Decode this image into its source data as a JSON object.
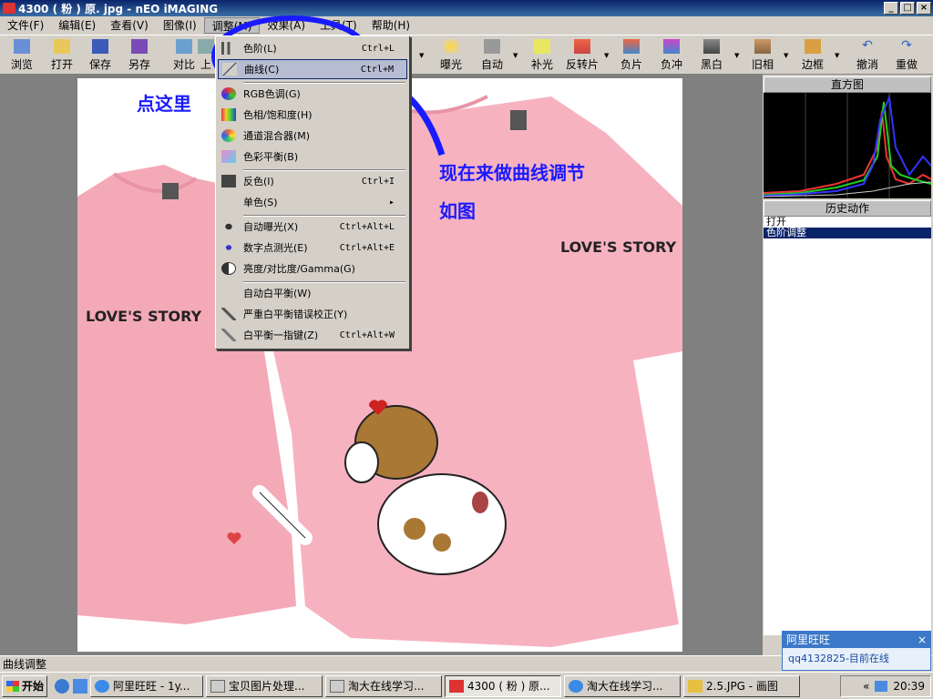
{
  "window": {
    "title": "4300 ( 粉 ) 原. jpg - nEO iMAGING",
    "buttons": [
      "_",
      "□",
      "×"
    ]
  },
  "menubar": [
    "文件(F)",
    "编辑(E)",
    "查看(V)",
    "图像(I)",
    "调整(M)",
    "效果(A)",
    "工具(T)",
    "帮助(H)"
  ],
  "toolbar": {
    "browse": "浏览",
    "open": "打开",
    "save": "保存",
    "saveas": "另存",
    "compare": "对比",
    "up": "上",
    "exposure": "曝光",
    "auto": "自动",
    "fill": "补光",
    "reverse": "反转片",
    "negative": "负片",
    "negative_process": "负冲",
    "bw": "黑白",
    "old": "旧相",
    "border": "边框",
    "undo": "撤消",
    "redo": "重做"
  },
  "dropdown": {
    "levels": {
      "label": "色阶(L)",
      "shortcut": "Ctrl+L"
    },
    "curves": {
      "label": "曲线(C)",
      "shortcut": "Ctrl+M"
    },
    "rgb": {
      "label": "RGB色调(G)"
    },
    "huesat": {
      "label": "色相/饱和度(H)"
    },
    "channel": {
      "label": "通道混合器(M)"
    },
    "colorbal": {
      "label": "色彩平衡(B)"
    },
    "invert": {
      "label": "反色(I)",
      "shortcut": "Ctrl+I"
    },
    "mono": {
      "label": "单色(S)",
      "arrow": "▸"
    },
    "autoexp": {
      "label": "自动曝光(X)",
      "shortcut": "Ctrl+Alt+L"
    },
    "digimeter": {
      "label": "数字点测光(E)",
      "shortcut": "Ctrl+Alt+E"
    },
    "brightness": {
      "label": "亮度/对比度/Gamma(G)"
    },
    "autowb": {
      "label": "自动白平衡(W)"
    },
    "wbfix": {
      "label": "严重白平衡错误校正(Y)"
    },
    "wbone": {
      "label": "白平衡一指键(Z)",
      "shortcut": "Ctrl+Alt+W"
    }
  },
  "annotations": {
    "click_here": "点这里",
    "instruction_1": "现在来做曲线调节",
    "instruction_2": "如图"
  },
  "photo": {
    "shirt_text_left": "LOVE'S STORY",
    "shirt_text_right": "LOVE'S STORY"
  },
  "panels": {
    "histogram_title": "直方图",
    "history_title": "历史动作",
    "history_items": [
      "打开",
      "色阶调整"
    ]
  },
  "statusbar": {
    "text": "曲线调整"
  },
  "taskbar": {
    "start": "开始",
    "tasks": [
      "阿里旺旺 - 1y...",
      "宝贝图片处理...",
      "淘大在线学习...",
      "4300 ( 粉 ) 原...",
      "淘大在线学习...",
      "2.5.JPG - 画图"
    ],
    "clock": "20:39",
    "tray_arrow": "«"
  },
  "notify": {
    "title": "阿里旺旺",
    "close": "×",
    "message": "qq4132825-目前在线"
  },
  "colors": {
    "accent": "#0a246a",
    "annotation": "#1a1aff",
    "shirt": "#f4a9b7",
    "highlight": "#b6bdd2"
  }
}
